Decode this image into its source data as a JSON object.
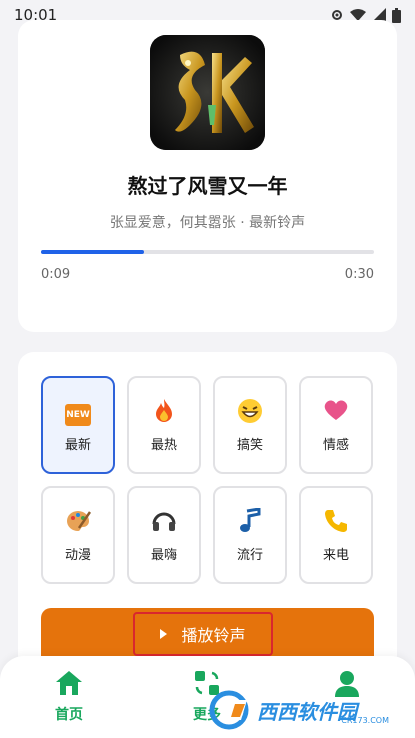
{
  "status_bar": {
    "time": "10:01"
  },
  "player": {
    "title": "熬过了风雪又一年",
    "subtitle": "张显爱意，何其嚣张 · 最新铃声",
    "current_time": "0:09",
    "total_time": "0:30",
    "progress_fraction": 0.31
  },
  "categories": [
    {
      "label": "最新",
      "icon": "new-icon",
      "active": true
    },
    {
      "label": "最热",
      "icon": "fire-icon",
      "active": false
    },
    {
      "label": "搞笑",
      "icon": "laugh-icon",
      "active": false
    },
    {
      "label": "情感",
      "icon": "heart-icon",
      "active": false
    },
    {
      "label": "动漫",
      "icon": "palette-icon",
      "active": false
    },
    {
      "label": "最嗨",
      "icon": "headphones-icon",
      "active": false
    },
    {
      "label": "流行",
      "icon": "music-note-icon",
      "active": false
    },
    {
      "label": "来电",
      "icon": "phone-icon",
      "active": false
    }
  ],
  "play_button": {
    "label": "播放铃声"
  },
  "nav": {
    "items": [
      {
        "label": "首页",
        "icon": "home-icon"
      },
      {
        "label": "更多",
        "icon": "more-icon"
      },
      {
        "label": "",
        "icon": "user-icon"
      }
    ]
  },
  "watermark": {
    "text": "西西软件园",
    "sub": "CR173.COM"
  },
  "colors": {
    "accent_blue": "#1f62e8",
    "play_orange": "#e5730c",
    "nav_green": "#19a75d"
  }
}
